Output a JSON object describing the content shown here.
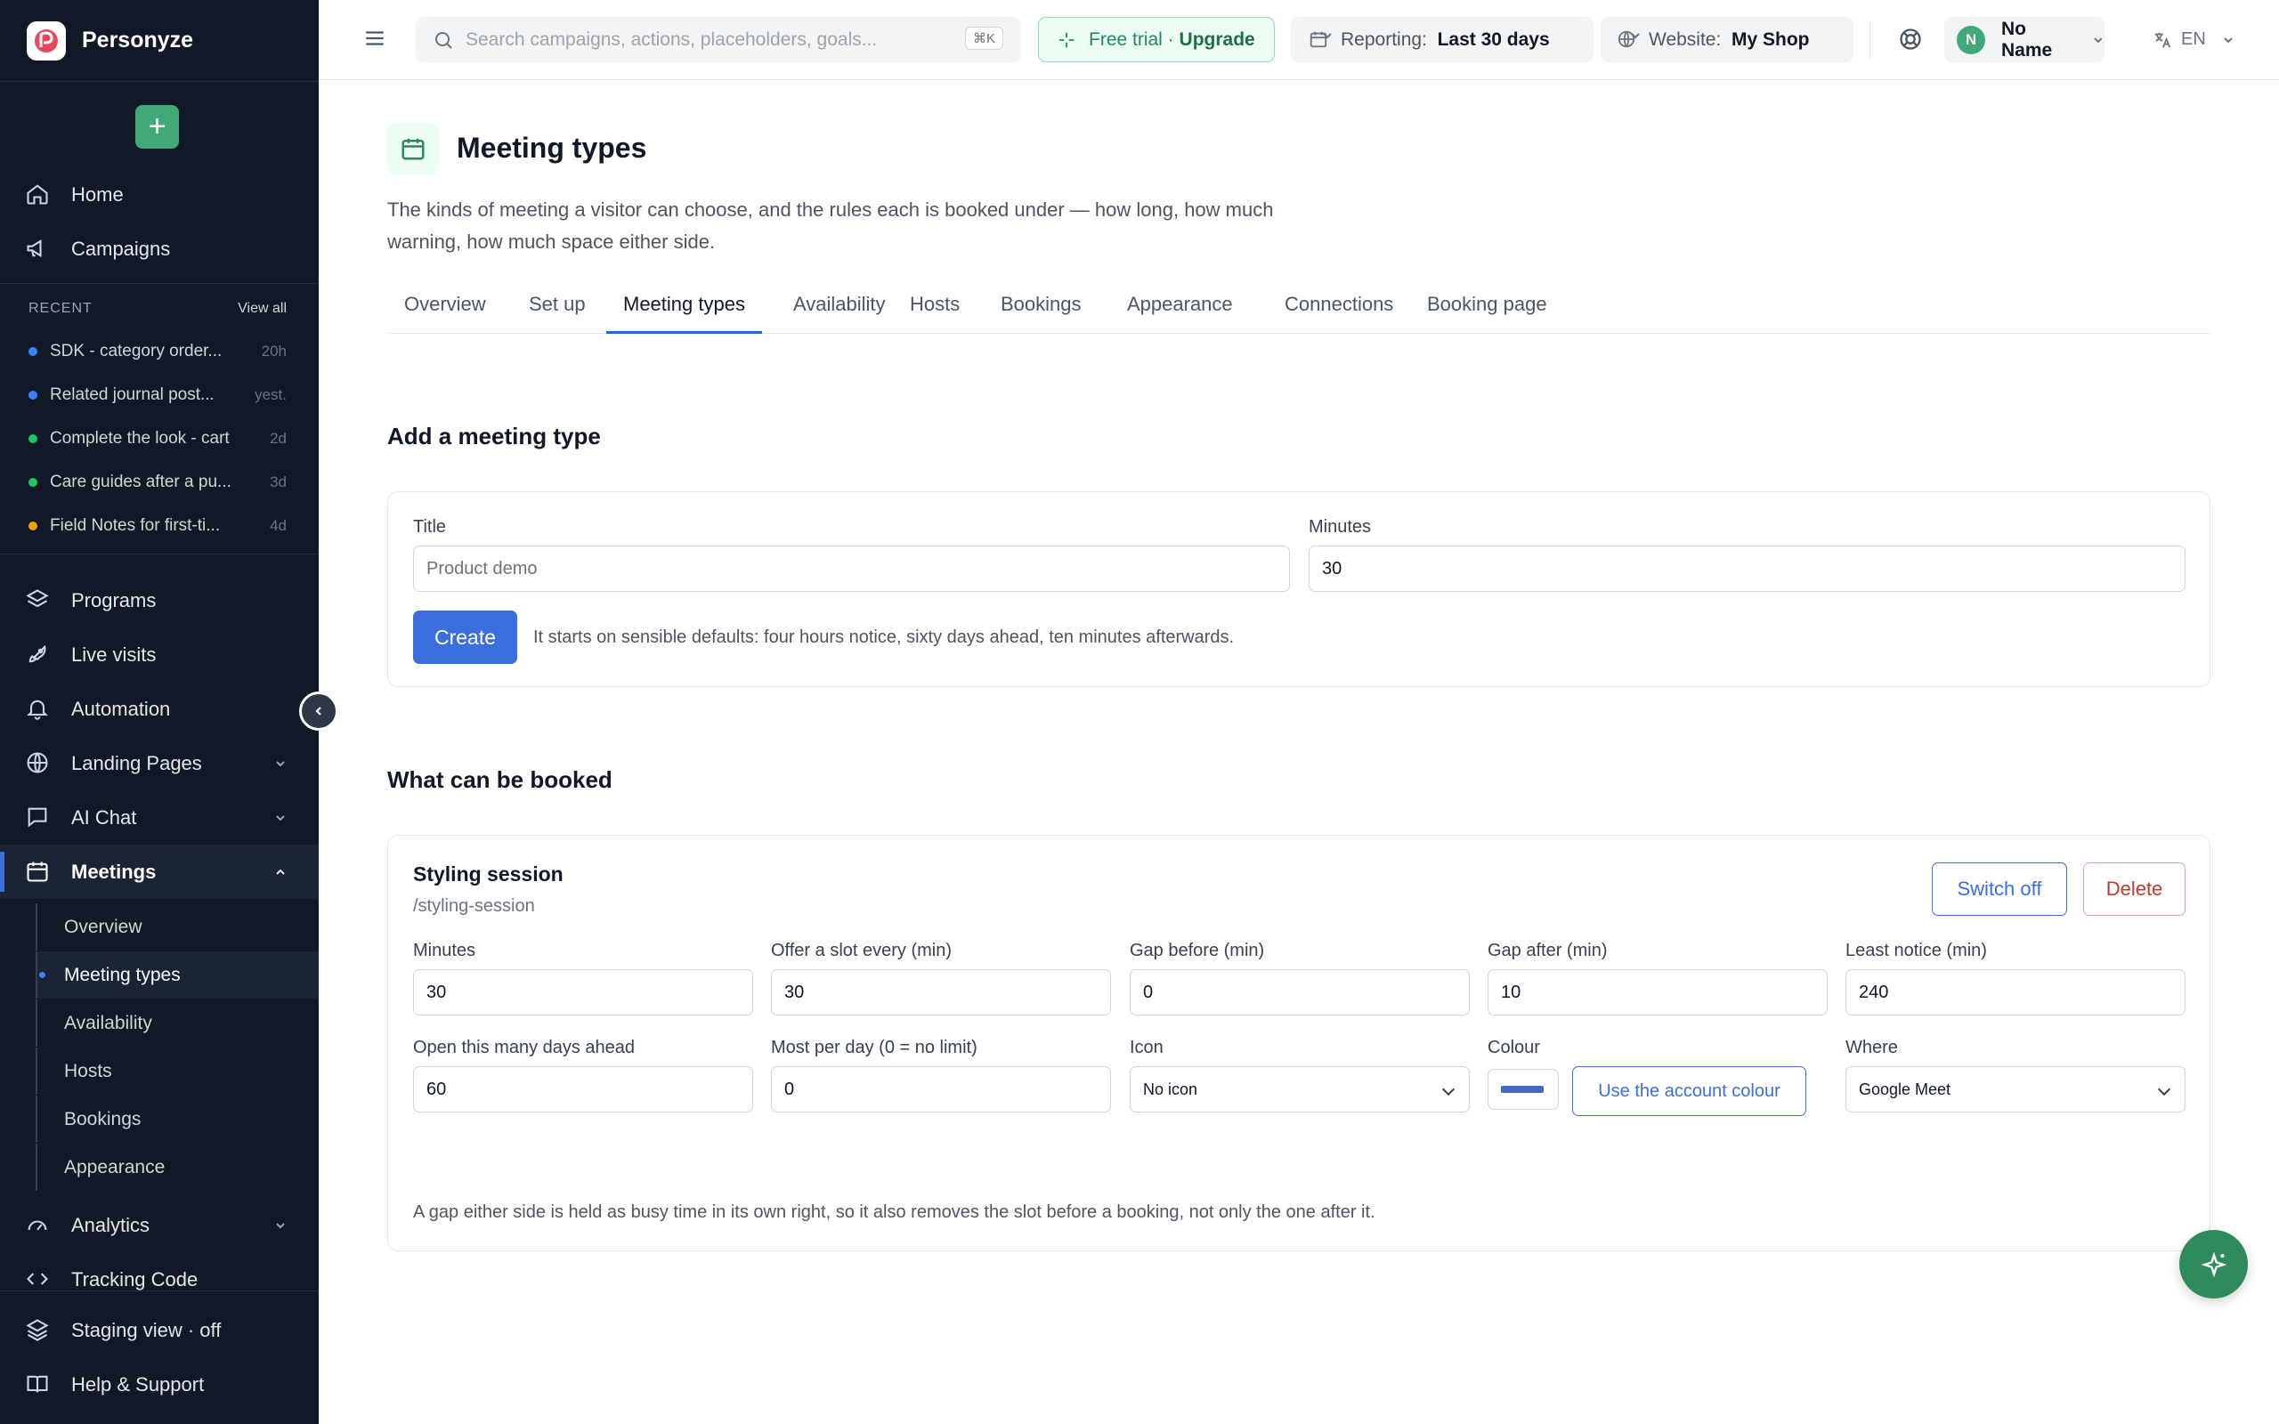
{
  "brand": {
    "name": "Personyze"
  },
  "nav": {
    "home": "Home",
    "campaigns": "Campaigns",
    "recent_title": "RECENT",
    "view_all": "View all",
    "recent": [
      {
        "label": "SDK - category order...",
        "age": "20h",
        "color": "#3b82f6"
      },
      {
        "label": "Related journal post...",
        "age": "yest.",
        "color": "#3b82f6"
      },
      {
        "label": "Complete the look - cart",
        "age": "2d",
        "color": "#22c55e"
      },
      {
        "label": "Care guides after a pu...",
        "age": "3d",
        "color": "#22c55e"
      },
      {
        "label": "Field Notes for first-ti...",
        "age": "4d",
        "color": "#f59e0b"
      }
    ],
    "programs": "Programs",
    "live_visits": "Live visits",
    "automation": "Automation",
    "landing_pages": "Landing Pages",
    "ai_chat": "AI Chat",
    "meetings": "Meetings",
    "meetings_sub": [
      "Overview",
      "Meeting types",
      "Availability",
      "Hosts",
      "Bookings",
      "Appearance"
    ],
    "analytics": "Analytics",
    "tracking_code": "Tracking Code",
    "staging_view": "Staging view · off",
    "help": "Help & Support"
  },
  "topbar": {
    "search_placeholder": "Search campaigns, actions, placeholders, goals...",
    "shortcut": "⌘K",
    "trial_label": "Free trial ·",
    "trial_upgrade": "Upgrade",
    "reporting_label": "Reporting:",
    "reporting_value": "Last 30 days",
    "website_label": "Website:",
    "website_value": "My Shop",
    "user_initial": "N",
    "user_name": "No Name",
    "lang": "EN"
  },
  "page": {
    "title": "Meeting types",
    "description": "The kinds of meeting a visitor can choose, and the rules each is booked under — how long, how much warning, how much space either side.",
    "tabs": [
      "Overview",
      "Set up",
      "Meeting types",
      "Availability",
      "Hosts",
      "Bookings",
      "Appearance",
      "Connections",
      "Booking page"
    ],
    "active_tab": "Meeting types"
  },
  "add_form": {
    "heading": "Add a meeting type",
    "title_label": "Title",
    "title_placeholder": "Product demo",
    "minutes_label": "Minutes",
    "minutes_value": "30",
    "create_label": "Create",
    "hint": "It starts on sensible defaults: four hours notice, sixty days ahead, ten minutes afterwards."
  },
  "bookable": {
    "heading": "What can be booked",
    "item": {
      "name": "Styling session",
      "slug": "/styling-session",
      "switch_off": "Switch off",
      "delete": "Delete",
      "minutes_label": "Minutes",
      "minutes": "30",
      "slot_label": "Offer a slot every (min)",
      "slot": "30",
      "gap_before_label": "Gap before (min)",
      "gap_before": "0",
      "gap_after_label": "Gap after (min)",
      "gap_after": "10",
      "notice_label": "Least notice (min)",
      "notice": "240",
      "days_label": "Open this many days ahead",
      "days": "60",
      "per_day_label": "Most per day (0 = no limit)",
      "per_day": "0",
      "icon_label": "Icon",
      "icon_value": "No icon",
      "colour_label": "Colour",
      "colour": "#4868c4",
      "use_account_colour": "Use the account colour",
      "where_label": "Where",
      "where_value": "Google Meet",
      "note": "A gap either side is held as busy time in its own right, so it also removes the slot before a booking, not only the one after it."
    }
  }
}
